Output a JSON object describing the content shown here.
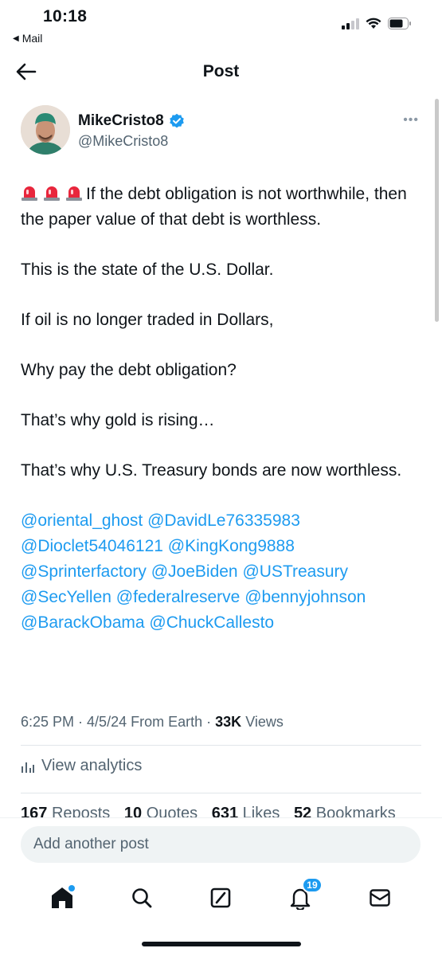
{
  "status_bar": {
    "time": "10:18",
    "back_app": "Mail"
  },
  "header": {
    "title": "Post"
  },
  "author": {
    "name": "MikeCristo8",
    "handle": "@MikeCristo8",
    "verified_color": "#1d9bf0"
  },
  "post": {
    "paragraph_1": "If the debt obligation is not worthwhile, then the paper value of that debt is worthless.",
    "paragraph_2": "This is the state of the U.S. Dollar.",
    "paragraph_3": "If oil is no longer traded in Dollars,",
    "paragraph_4": "Why pay the debt obligation?",
    "paragraph_5": "That’s why gold is rising…",
    "paragraph_6": "That’s why U.S. Treasury bonds are now worthless.",
    "mentions": [
      "@oriental_ghost",
      "@DavidLe76335983",
      "@Dioclet54046121",
      "@KingKong9888",
      "@Sprinterfactory",
      "@JoeBiden",
      "@USTreasury",
      "@SecYellen",
      "@federalreserve",
      "@bennyjohnson",
      "@BarackObama",
      "@ChuckCallesto"
    ],
    "siren_icon": "siren-emoji"
  },
  "meta": {
    "time": "6:25 PM",
    "date": "4/5/24",
    "location": "From Earth",
    "views_count": "33K",
    "views_label": "Views"
  },
  "analytics": {
    "label": "View analytics"
  },
  "stats": {
    "reposts_count": "167",
    "reposts_label": "Reposts",
    "quotes_count": "10",
    "quotes_label": "Quotes",
    "likes_count": "631",
    "likes_label": "Likes",
    "bookmarks_count": "52",
    "bookmarks_label": "Bookmarks"
  },
  "reply": {
    "placeholder": "Add another post"
  },
  "nav": {
    "notifications_badge": "19",
    "accent": "#1d9bf0"
  }
}
